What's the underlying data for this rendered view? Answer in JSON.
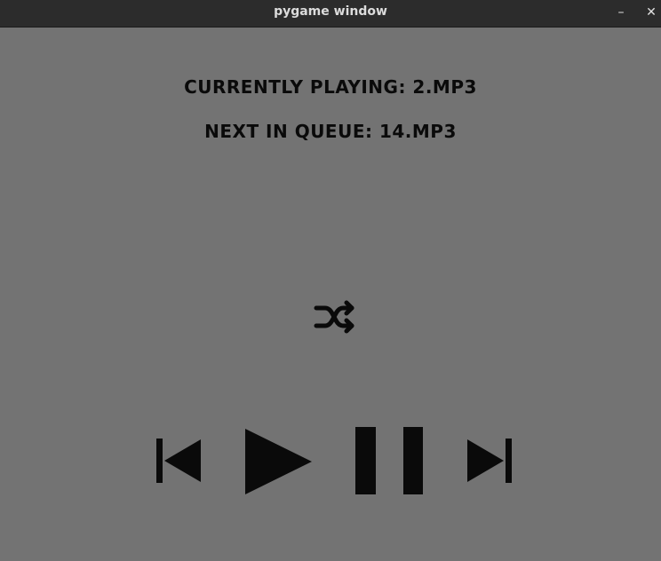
{
  "window": {
    "title": "pygame window",
    "minimize_glyph": "–",
    "close_glyph": "✕"
  },
  "player": {
    "currently_playing": "CURRENTLY PLAYING: 2.MP3",
    "next_in_queue": "NEXT IN QUEUE: 14.MP3"
  },
  "controls": {
    "shuffle_icon": "shuffle-icon",
    "previous_icon": "skip-previous-icon",
    "play_icon": "play-icon",
    "pause_icon": "pause-icon",
    "next_icon": "skip-next-icon"
  },
  "colors": {
    "background": "#737373",
    "titlebar": "#2c2c2c",
    "foreground": "#0a0a0a"
  }
}
